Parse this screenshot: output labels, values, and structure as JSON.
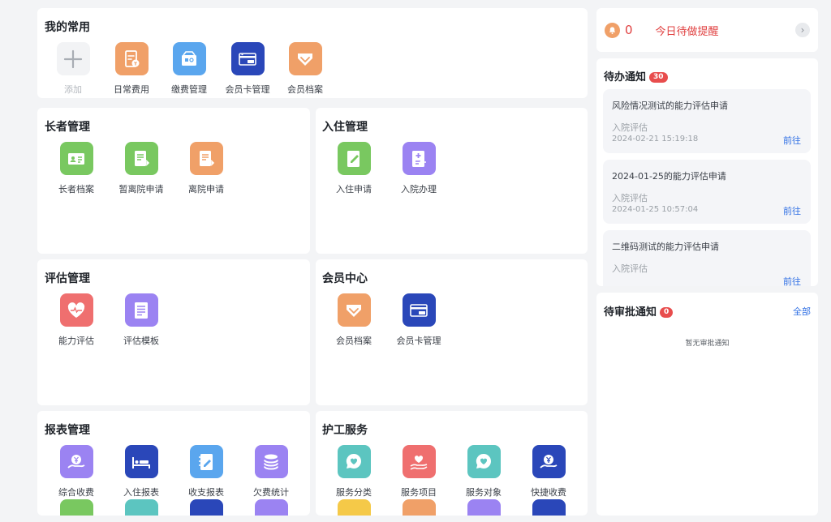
{
  "favorites": {
    "title": "我的常用",
    "items": [
      {
        "label": "添加",
        "icon": "plus-icon"
      },
      {
        "label": "日常费用",
        "icon": "expense-doc-icon"
      },
      {
        "label": "缴费管理",
        "icon": "payment-icon"
      },
      {
        "label": "会员卡管理",
        "icon": "vip-card-icon"
      },
      {
        "label": "会员档案",
        "icon": "member-diamond-icon"
      }
    ]
  },
  "elder": {
    "title": "长者管理",
    "items": [
      {
        "label": "长者档案",
        "icon": "id-card-icon"
      },
      {
        "label": "暂离院申请",
        "icon": "leave-form-icon"
      },
      {
        "label": "离院申请",
        "icon": "discharge-form-icon"
      }
    ]
  },
  "checkin": {
    "title": "入住管理",
    "items": [
      {
        "label": "入住申请",
        "icon": "edit-doc-icon"
      },
      {
        "label": "入院办理",
        "icon": "admission-icon"
      }
    ]
  },
  "assess": {
    "title": "评估管理",
    "items": [
      {
        "label": "能力评估",
        "icon": "heart-pulse-icon"
      },
      {
        "label": "评估模板",
        "icon": "template-icon"
      }
    ]
  },
  "member": {
    "title": "会员中心",
    "items": [
      {
        "label": "会员档案",
        "icon": "member-diamond-icon"
      },
      {
        "label": "会员卡管理",
        "icon": "vip-card-icon"
      }
    ]
  },
  "report": {
    "title": "报表管理",
    "items": [
      {
        "label": "综合收费",
        "icon": "yen-hand-icon"
      },
      {
        "label": "入住报表",
        "icon": "bed-icon"
      },
      {
        "label": "收支报表",
        "icon": "notebook-edit-icon"
      },
      {
        "label": "欠费统计",
        "icon": "coins-stack-icon"
      }
    ]
  },
  "care": {
    "title": "护工服务",
    "items": [
      {
        "label": "服务分类",
        "icon": "heart-bubble-icon"
      },
      {
        "label": "服务项目",
        "icon": "heart-hand-icon"
      },
      {
        "label": "服务对象",
        "icon": "heart-bubble-icon"
      },
      {
        "label": "快捷收费",
        "icon": "yen-hand-icon"
      }
    ]
  },
  "reminder": {
    "count": "0",
    "text": "今日待做提醒",
    "arrow": "›"
  },
  "todo": {
    "title": "待办通知",
    "badge": "30",
    "items": [
      {
        "title": "风险情况测试的能力评估申请",
        "type": "入院评估",
        "time": "2024-02-21 15:19:18",
        "action": "前往"
      },
      {
        "title": "2024-01-25的能力评估申请",
        "type": "入院评估",
        "time": "2024-01-25 10:57:04",
        "action": "前往"
      },
      {
        "title": "二维码测试的能力评估申请",
        "type": "入院评估",
        "time": "",
        "action": "前往"
      }
    ]
  },
  "approval": {
    "title": "待审批通知",
    "badge": "0",
    "all_label": "全部",
    "empty": "暂无审批通知"
  },
  "colors": {
    "orange": "#f0a068",
    "blue": "#5aa6ee",
    "navy": "#2a47b9",
    "green": "#79c860",
    "purple": "#9b83f2",
    "red": "#ef6f6f",
    "teal": "#5cc5c0",
    "link": "#2f6fe4",
    "alert": "#e04040"
  }
}
